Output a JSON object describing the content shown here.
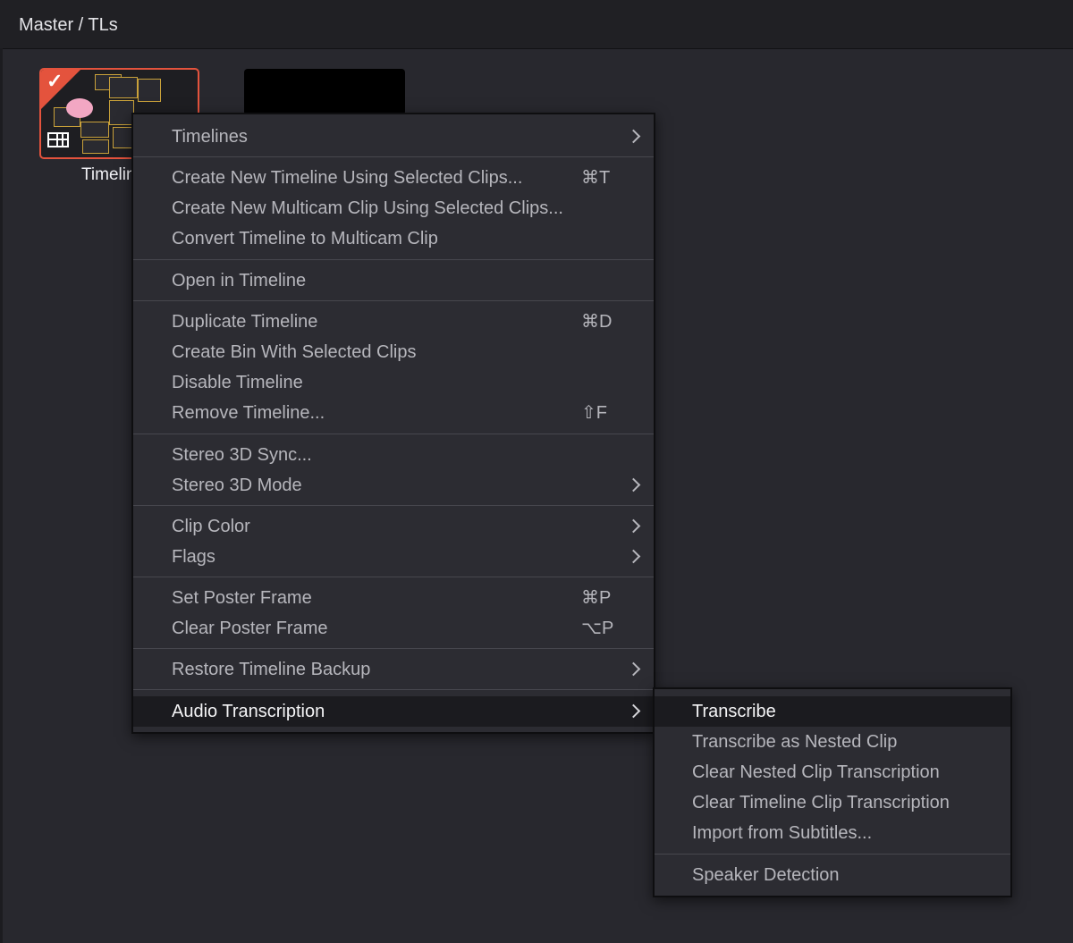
{
  "header": {
    "breadcrumb": "Master / TLs"
  },
  "clip": {
    "label": "Timelin"
  },
  "context_menu": {
    "items": [
      {
        "label": "Timelines",
        "submenu": true
      },
      {
        "label": "Create New Timeline Using Selected Clips...",
        "shortcut": "⌘T"
      },
      {
        "label": "Create New Multicam Clip Using Selected Clips..."
      },
      {
        "label": "Convert Timeline to Multicam Clip"
      },
      {
        "label": "Open in Timeline"
      },
      {
        "label": "Duplicate Timeline",
        "shortcut": "⌘D"
      },
      {
        "label": "Create Bin With Selected Clips"
      },
      {
        "label": "Disable Timeline"
      },
      {
        "label": "Remove Timeline...",
        "shortcut": "⇧F"
      },
      {
        "label": "Stereo 3D Sync..."
      },
      {
        "label": "Stereo 3D Mode",
        "submenu": true
      },
      {
        "label": "Clip Color",
        "submenu": true
      },
      {
        "label": "Flags",
        "submenu": true
      },
      {
        "label": "Set Poster Frame",
        "shortcut": "⌘P"
      },
      {
        "label": "Clear Poster Frame",
        "shortcut": "⌥P"
      },
      {
        "label": "Restore Timeline Backup",
        "submenu": true
      },
      {
        "label": "Audio Transcription",
        "submenu": true,
        "highlighted": true
      }
    ]
  },
  "submenu": {
    "items": [
      {
        "label": "Transcribe",
        "highlighted": true
      },
      {
        "label": "Transcribe as Nested Clip"
      },
      {
        "label": "Clear Nested Clip Transcription"
      },
      {
        "label": "Clear Timeline Clip Transcription"
      },
      {
        "label": "Import from Subtitles..."
      },
      {
        "label": "Speaker Detection"
      }
    ]
  },
  "colors": {
    "selection_border": "#e4533d",
    "menu_bg": "#2c2c32",
    "highlight_bg": "#1b1b1f"
  },
  "icons": {
    "selected": "checkmark-icon",
    "timeline": "timeline-icon",
    "submenu": "chevron-right-icon"
  }
}
